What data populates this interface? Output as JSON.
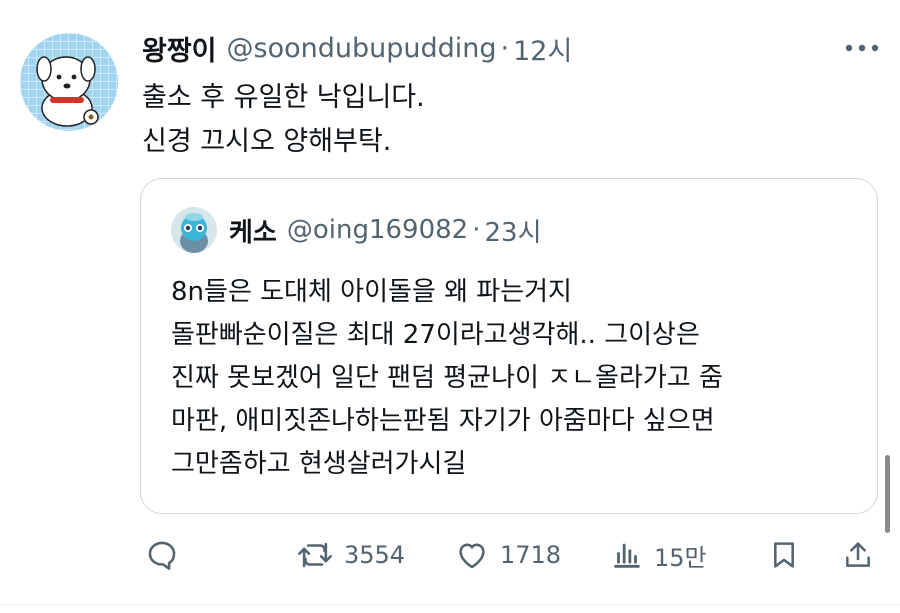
{
  "tweet": {
    "display_name": "왕짱이",
    "handle": "@soondubupudding",
    "separator": "·",
    "time": "12시",
    "avatar_icon": "white-puppy-avatar-icon",
    "more_icon": "more-dots-icon",
    "text_lines": [
      "출소 후 유일한 낙입니다.",
      "신경 끄시오 양해부탁."
    ]
  },
  "quote": {
    "display_name": "케소",
    "handle": "@oing169082",
    "separator": "·",
    "time": "23시",
    "avatar_icon": "blue-character-avatar-icon",
    "text_lines": [
      "8n들은 도대체 아이돌을 왜 파는거지",
      "돌판빠순이질은 최대 27이라고생각해.. 그이상은",
      "진짜 못보겠어 일단 팬덤 평균나이 ㅈㄴ올라가고 줌",
      "마판, 애미짓존나하는판됨 자기가 아줌마다 싶으면",
      "그만좀하고 현생살러가시길"
    ]
  },
  "actions": {
    "reply_icon": "reply-bubble-icon",
    "retweet_icon": "retweet-icon",
    "retweet_count": "3554",
    "like_icon": "heart-icon",
    "like_count": "1718",
    "views_icon": "views-bar-chart-icon",
    "views_count": "15만",
    "bookmark_icon": "bookmark-icon",
    "share_icon": "share-upload-icon"
  },
  "colors": {
    "text_primary": "#0f1419",
    "text_secondary": "#536471",
    "border": "#cfd9de",
    "avatar_bg": "#9fd3ef"
  }
}
